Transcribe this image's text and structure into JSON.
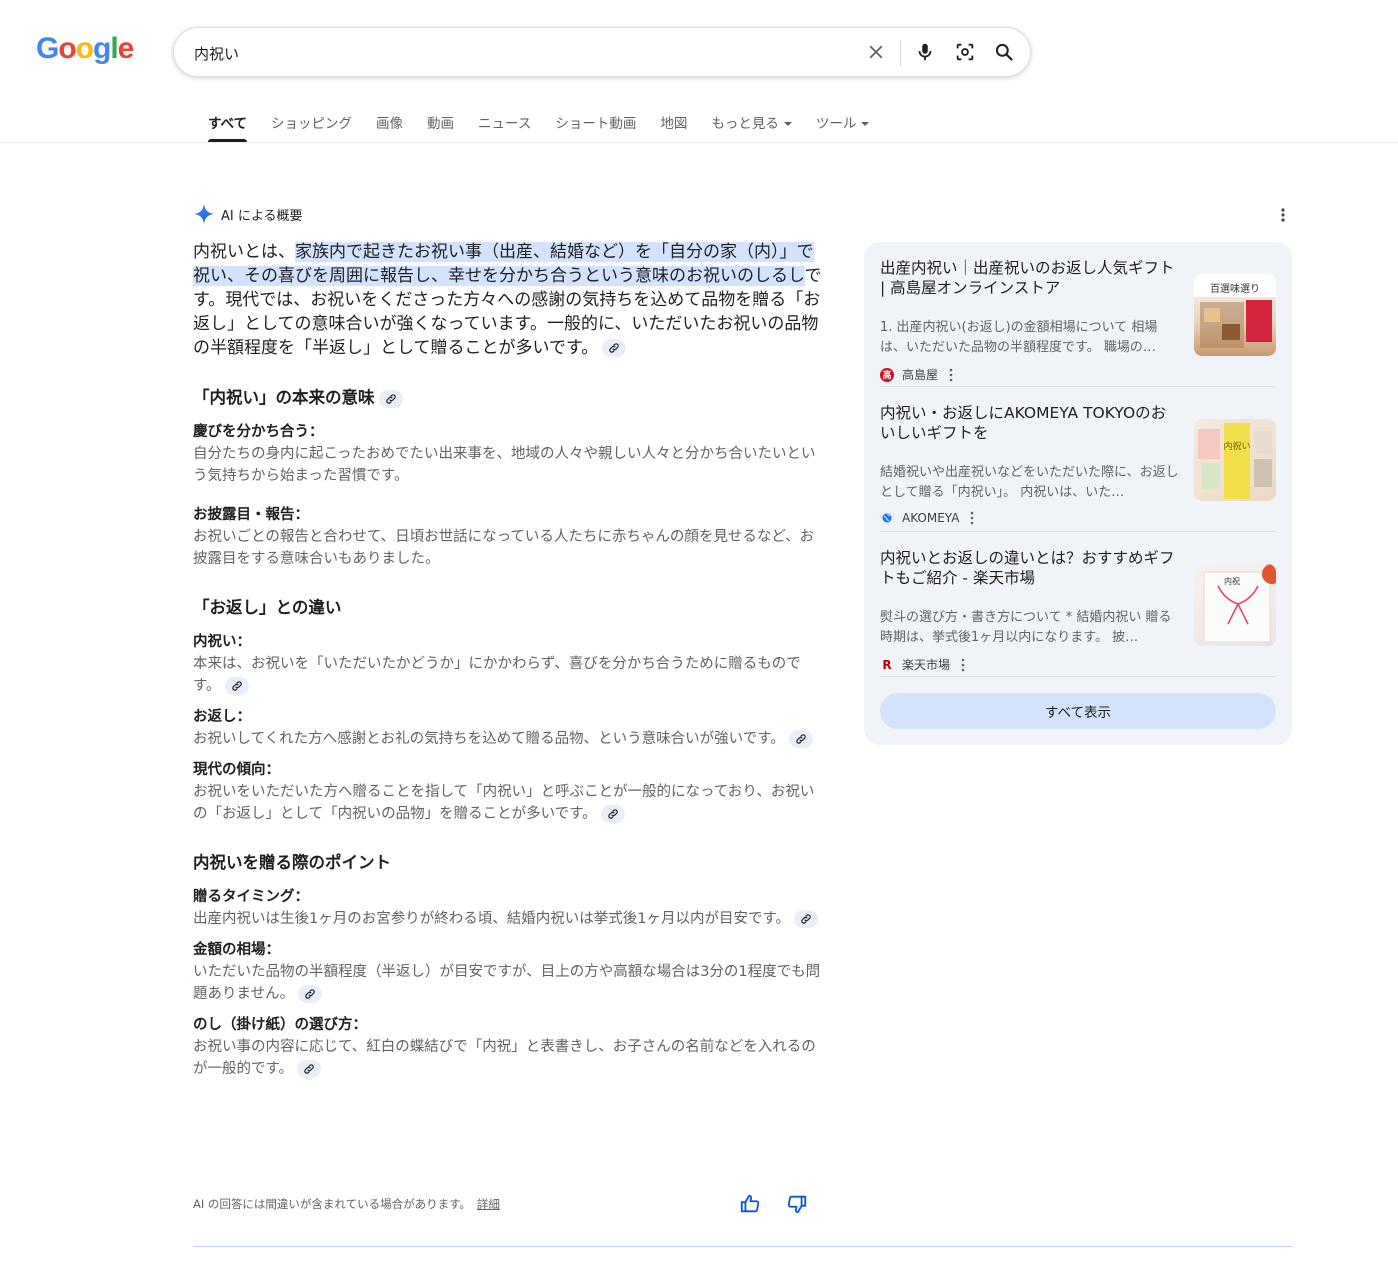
{
  "logo": {
    "letters": [
      "G",
      "o",
      "o",
      "g",
      "l",
      "e"
    ],
    "colors": [
      "#4285f4",
      "#ea4335",
      "#fbbc05",
      "#4285f4",
      "#34a853",
      "#ea4335"
    ]
  },
  "search": {
    "query": "内祝い"
  },
  "tabs": [
    {
      "label": "すべて",
      "active": true
    },
    {
      "label": "ショッピング"
    },
    {
      "label": "画像"
    },
    {
      "label": "動画"
    },
    {
      "label": "ニュース"
    },
    {
      "label": "ショート動画"
    },
    {
      "label": "地図"
    },
    {
      "label": "もっと見る",
      "dropdown": true
    },
    {
      "label": "ツール",
      "dropdown": true
    }
  ],
  "ai": {
    "heading": "AI による概要",
    "intro_prefix": "内祝いとは、",
    "intro_highlight": "家族内で起きたお祝い事（出産、結婚など）を「自分の家（内）」で祝い、その喜びを周囲に報告し、幸せを分かち合うという意味のお祝いのしるし",
    "intro_suffix": "です。現代では、お祝いをくださった方々への感謝の気持ちを込めて品物を贈る「お返し」としての意味合いが強くなっています。一般的に、いただいたお祝いの品物の半額程度を「半返し」として贈ることが多いです。",
    "sections": [
      {
        "title": "「内祝い」の本来の意味",
        "cite": true,
        "items": [
          {
            "term": "慶びを分かち合う：",
            "desc": "自分たちの身内に起こったおめでたい出来事を、地域の人々や親しい人々と分かち合いたいという気持ちから始まった習慣です。"
          },
          {
            "term": "お披露目・報告：",
            "desc": "お祝いごとの報告と合わせて、日頃お世話になっている人たちに赤ちゃんの顔を見せるなど、お披露目をする意味合いもありました。"
          }
        ]
      },
      {
        "title": "「お返し」との違い",
        "items": [
          {
            "term": "内祝い：",
            "desc": "本来は、お祝いを「いただいたかどうか」にかかわらず、喜びを分かち合うために贈るものです。",
            "cite": true
          },
          {
            "term": "お返し：",
            "desc": "お祝いしてくれた方へ感謝とお礼の気持ちを込めて贈る品物、という意味合いが強いです。",
            "cite": true
          },
          {
            "term": "現代の傾向：",
            "desc": "お祝いをいただいた方へ贈ることを指して「内祝い」と呼ぶことが一般的になっており、お祝いの「お返し」として「内祝いの品物」を贈ることが多いです。",
            "cite": true
          }
        ]
      },
      {
        "title": "内祝いを贈る際のポイント",
        "items": [
          {
            "term": "贈るタイミング：",
            "desc": "出産内祝いは生後1ヶ月のお宮参りが終わる頃、結婚内祝いは挙式後1ヶ月以内が目安です。",
            "cite": true
          },
          {
            "term": "金額の相場：",
            "desc": "いただいた品物の半額程度（半返し）が目安ですが、目上の方や高額な場合は3分の1程度でも問題ありません。",
            "cite": true
          },
          {
            "term": "のし（掛け紙）の選び方：",
            "desc": "お祝い事の内容に応じて、紅白の蝶結びで「内祝」と表書きし、お子さんの名前などを入れるのが一般的です。",
            "cite": true
          }
        ]
      }
    ],
    "disclaimer": "AI の回答には間違いが含まれている場合があります。",
    "details_link": "詳細"
  },
  "sources": [
    {
      "title": "出産内祝い｜出産祝いのお返し人気ギフト | 高島屋オンラインストア",
      "snippet": "1. 出産内祝い(お返し)の金額相場について 相場は、いただいた品物の半額程度です。 職場の…",
      "site": "高島屋",
      "favicon_color": "#d50f25",
      "img_text": "百選味選り"
    },
    {
      "title": "内祝い・お返しにAKOMEYA TOKYOのおいしいギフトを",
      "snippet": "結婚祝いや出産祝いなどをいただいた際に、お返しとして贈る「内祝い」。 内祝いは、いた…",
      "site": "AKOMEYA",
      "favicon_color": "#1a73e8",
      "img_text": "内祝い"
    },
    {
      "title": "内祝いとお返しの違いとは？おすすめギフトもご紹介 - 楽天市場",
      "snippet": "熨斗の選び方・書き方について * 結婚内祝い 贈る時期は、挙式後1ヶ月以内になります。 披…",
      "site": "楽天市場",
      "favicon_color": "#bf0000",
      "img_text": "内祝"
    }
  ],
  "show_all": "すべて表示"
}
